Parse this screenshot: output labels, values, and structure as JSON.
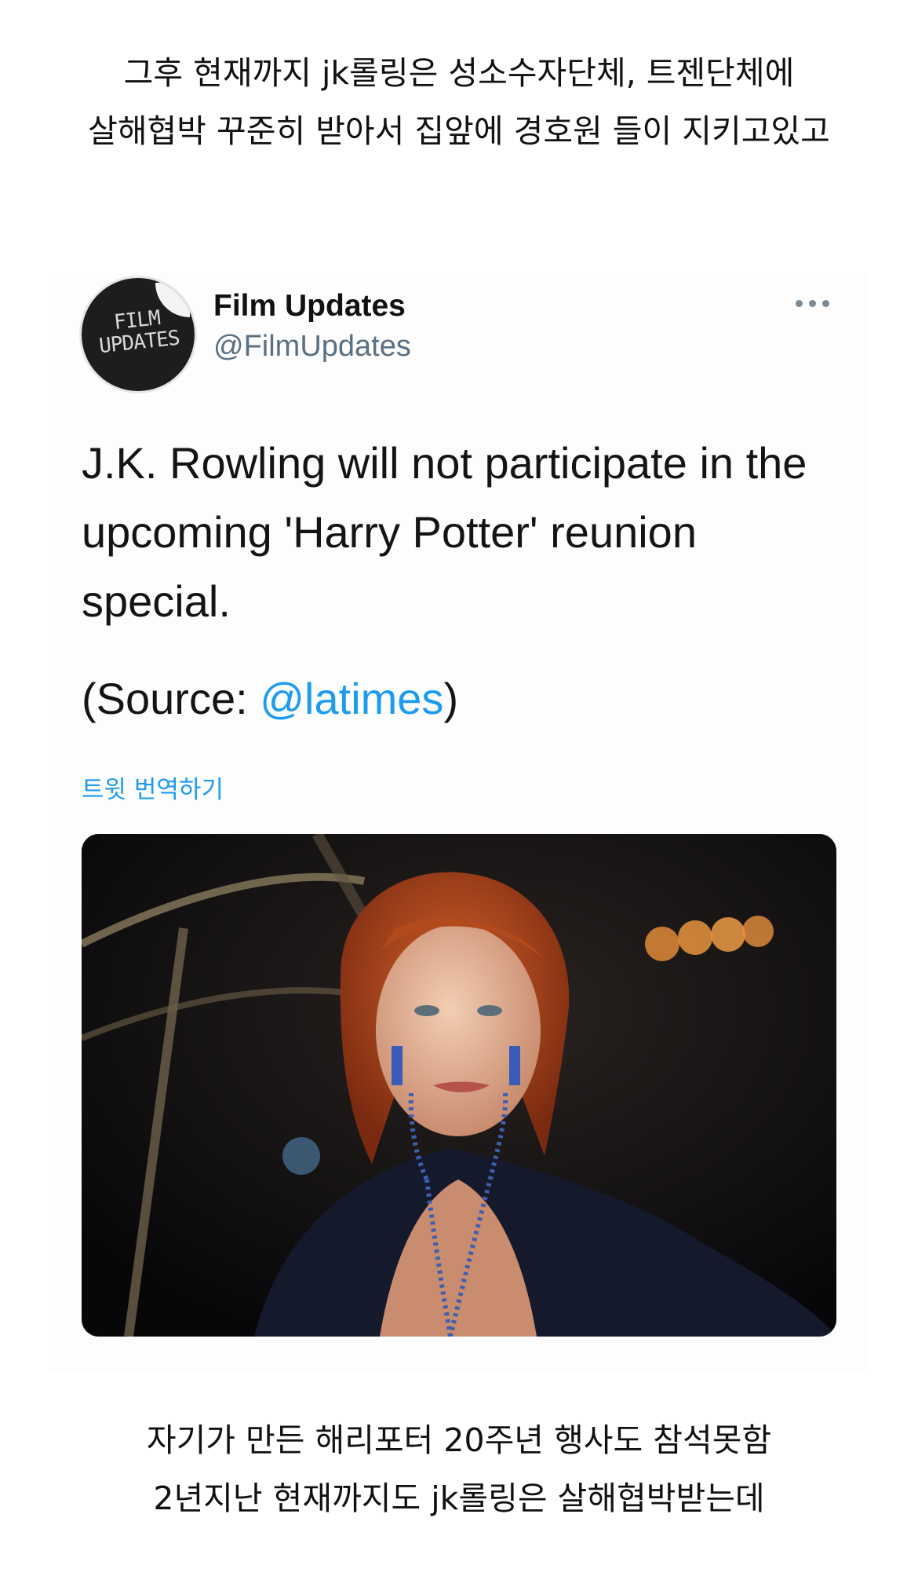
{
  "captions": {
    "top": "그후 현재까지 jk롤링은 성소수자단체, 트젠단체에\n살해협박 꾸준히 받아서 집앞에 경호원 들이 지키고있고",
    "bottom": "자기가 만든 해리포터 20주년 행사도 참석못함\n2년지난 현재까지도 jk롤링은 살해협박받는데"
  },
  "tweet": {
    "avatar_text": "FILM\nUPDATES",
    "display_name": "Film Updates",
    "handle": "@FilmUpdates",
    "more_icon": "more-horizontal-icon",
    "text": "J.K. Rowling will not participate in the upcoming 'Harry Potter' reunion special.",
    "source_prefix": "(Source: ",
    "source_mention": "@latimes",
    "source_suffix": ")",
    "translate_label": "트윗 번역하기",
    "photo_icon": "photo-of-woman-with-red-hair"
  },
  "colors": {
    "link": "#1d9bf0",
    "handle": "#5b7083",
    "card_bg": "#fdfdfd"
  }
}
